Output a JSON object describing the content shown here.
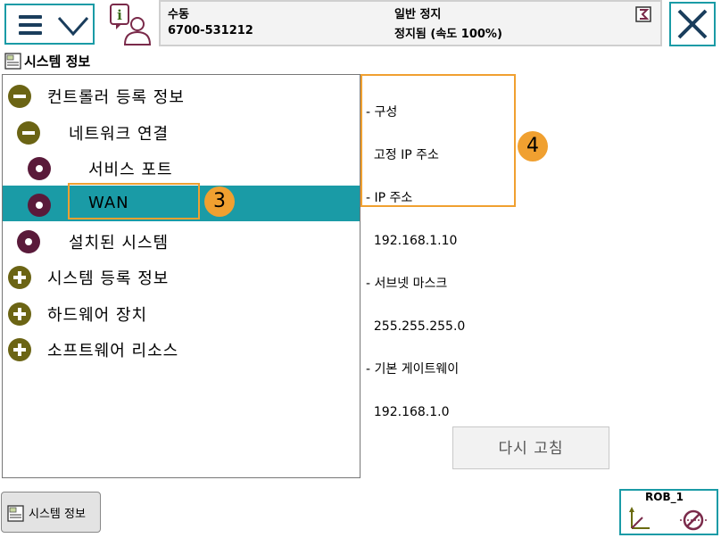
{
  "header": {
    "mode": "수동",
    "system_id": "6700-531212",
    "state": "일반 정지",
    "run_state": "정지됨 (속도 100%)"
  },
  "title": "시스템 정보",
  "tree": [
    {
      "label": "컨트롤러 등록 정보",
      "icon": "minus-circle-icon",
      "selected": false
    },
    {
      "label": "네트워크 연결",
      "icon": "minus-circle-icon",
      "selected": false
    },
    {
      "label": "서비스 포트",
      "icon": "node-circle-icon",
      "selected": false
    },
    {
      "label": "WAN",
      "icon": "node-circle-icon",
      "selected": true
    },
    {
      "label": "설치된 시스템",
      "icon": "node-circle-icon",
      "selected": false
    },
    {
      "label": "시스템 등록 정보",
      "icon": "plus-circle-icon",
      "selected": false
    },
    {
      "label": "하드웨어 장치",
      "icon": "plus-circle-icon",
      "selected": false
    },
    {
      "label": "소프트웨어 리소스",
      "icon": "plus-circle-icon",
      "selected": false
    }
  ],
  "details": [
    "- 구성",
    "  고정 IP 주소",
    "- IP 주소",
    "  192.168.1.10",
    "- 서브넷 마스크",
    "  255.255.255.0",
    "- 기본 게이트웨이",
    "  192.168.1.0"
  ],
  "callouts": {
    "wan": "3",
    "details": "4"
  },
  "buttons": {
    "refresh": "다시 고침"
  },
  "bottom_tab": {
    "label": "시스템 정보"
  },
  "robot": {
    "label": "ROB_1"
  },
  "colors": {
    "accent": "#1a9ba6",
    "callout": "#f0a030",
    "tree_icon": "#6b6414",
    "leaf_icon": "#5a1a3a"
  }
}
